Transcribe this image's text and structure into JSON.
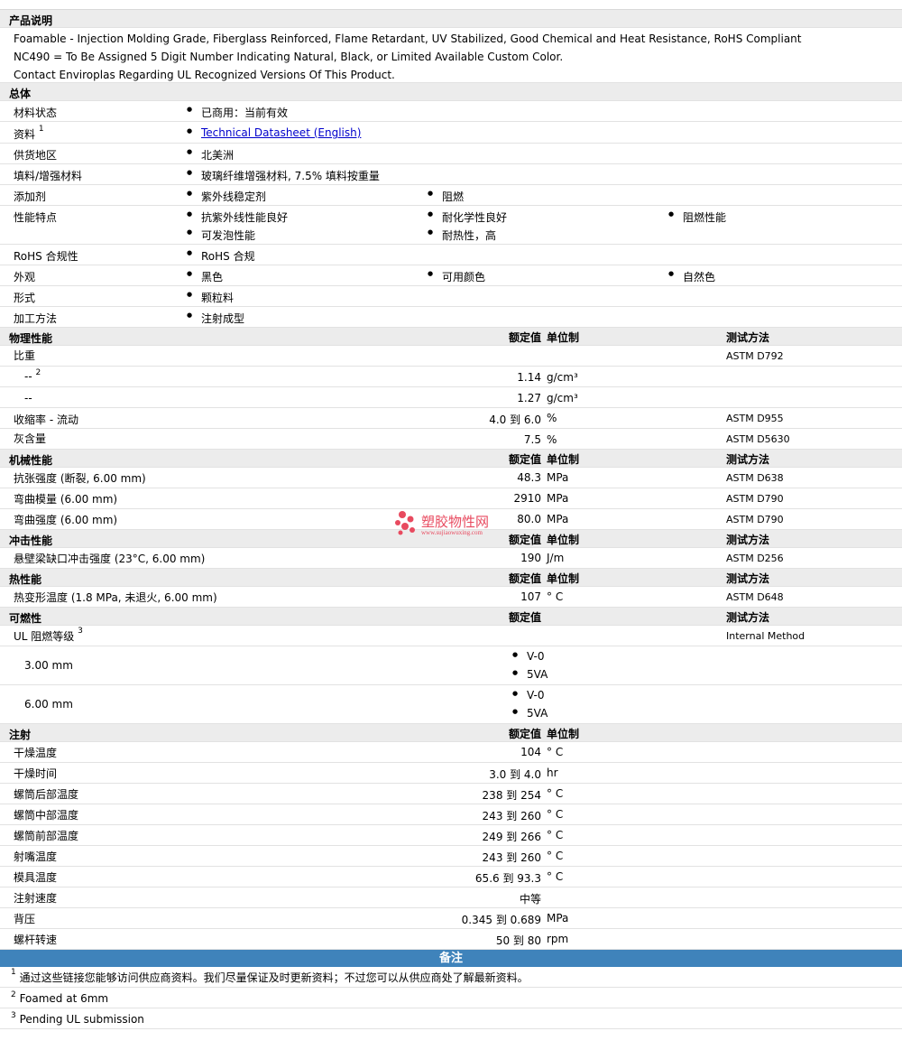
{
  "description": {
    "title": "产品说明",
    "lines": [
      "Foamable - Injection Molding Grade, Fiberglass Reinforced, Flame Retardant, UV Stabilized, Good Chemical and Heat Resistance, RoHS Compliant",
      "NC490 = To Be Assigned 5 Digit Number Indicating Natural, Black, or Limited Available Custom Color.",
      "Contact Enviroplas Regarding UL Recognized Versions Of This Product."
    ]
  },
  "general": {
    "title": "总体",
    "material_status": {
      "label": "材料状态",
      "value": "已商用：当前有效"
    },
    "documents": {
      "label": "资料",
      "sup": "1",
      "link": "Technical Datasheet (English)"
    },
    "availability": {
      "label": "供货地区",
      "value": "北美洲"
    },
    "filler": {
      "label": "填料/增强材料",
      "value": "玻璃纤维增强材料, 7.5% 填料按重量"
    },
    "additives": {
      "label": "添加剂",
      "values": [
        "紫外线稳定剂",
        "阻燃"
      ]
    },
    "features": {
      "label": "性能特点",
      "values": [
        "抗紫外线性能良好",
        "耐化学性良好",
        "阻燃性能",
        "可发泡性能",
        "耐热性，高"
      ]
    },
    "rohs": {
      "label": "RoHS 合规性",
      "value": "RoHS 合规"
    },
    "appearance": {
      "label": "外观",
      "values": [
        "黑色",
        "可用颜色",
        "自然色"
      ]
    },
    "forms": {
      "label": "形式",
      "value": "颗粒料"
    },
    "processing": {
      "label": "加工方法",
      "value": "注射成型"
    }
  },
  "col_headers": {
    "nominal": "额定值",
    "unit": "单位制",
    "method": "测试方法"
  },
  "physical": {
    "title": "物理性能",
    "rows": [
      {
        "label": "比重",
        "value": "",
        "unit": "",
        "method": "ASTM D792"
      },
      {
        "label": "--",
        "sup": "2",
        "value": "1.14",
        "unit": "g/cm³",
        "method": ""
      },
      {
        "label": "--",
        "value": "1.27",
        "unit": "g/cm³",
        "method": ""
      },
      {
        "label": "收缩率 - 流动",
        "value": "4.0 到 6.0",
        "unit": "%",
        "method": "ASTM D955"
      },
      {
        "label": "灰含量",
        "value": "7.5",
        "unit": "%",
        "method": "ASTM D5630"
      }
    ]
  },
  "mechanical": {
    "title": "机械性能",
    "rows": [
      {
        "label": "抗张强度 (断裂, 6.00 mm)",
        "value": "48.3",
        "unit": "MPa",
        "method": "ASTM D638"
      },
      {
        "label": "弯曲模量 (6.00 mm)",
        "value": "2910",
        "unit": "MPa",
        "method": "ASTM D790"
      },
      {
        "label": "弯曲强度 (6.00 mm)",
        "value": "80.0",
        "unit": "MPa",
        "method": "ASTM D790"
      }
    ]
  },
  "impact": {
    "title": "冲击性能",
    "rows": [
      {
        "label": "悬壁梁缺口冲击强度 (23°C, 6.00 mm)",
        "value": "190",
        "unit": "J/m",
        "method": "ASTM D256"
      }
    ]
  },
  "thermal": {
    "title": "热性能",
    "rows": [
      {
        "label": "热变形温度 (1.8 MPa, 未退火, 6.00 mm)",
        "value": "107",
        "unit": "° C",
        "method": "ASTM D648"
      }
    ]
  },
  "flammability": {
    "title": "可燃性",
    "ul": {
      "label": "UL 阻燃等级",
      "sup": "3",
      "method": "Internal Method"
    },
    "t300": {
      "label": "3.00 mm",
      "values": [
        "V-0",
        "5VA"
      ]
    },
    "t600": {
      "label": "6.00 mm",
      "values": [
        "V-0",
        "5VA"
      ]
    }
  },
  "injection": {
    "title": "注射",
    "rows": [
      {
        "label": "干燥温度",
        "value": "104",
        "unit": "° C"
      },
      {
        "label": "干燥时间",
        "value": "3.0 到 4.0",
        "unit": "hr"
      },
      {
        "label": "螺筒后部温度",
        "value": "238 到 254",
        "unit": "° C"
      },
      {
        "label": "螺筒中部温度",
        "value": "243 到 260",
        "unit": "° C"
      },
      {
        "label": "螺筒前部温度",
        "value": "249 到 266",
        "unit": "° C"
      },
      {
        "label": "射嘴温度",
        "value": "243 到 260",
        "unit": "° C"
      },
      {
        "label": "模具温度",
        "value": "65.6 到 93.3",
        "unit": "° C"
      },
      {
        "label": "注射速度",
        "value": "中等",
        "unit": ""
      },
      {
        "label": "背压",
        "value": "0.345 到 0.689",
        "unit": "MPa"
      },
      {
        "label": "螺杆转速",
        "value": "50 到 80",
        "unit": "rpm"
      }
    ]
  },
  "notes": {
    "title": "备注",
    "items": [
      {
        "num": "1",
        "text": "通过这些链接您能够访问供应商资料。我们尽量保证及时更新资料；不过您可以从供应商处了解最新资料。"
      },
      {
        "num": "2",
        "text": "Foamed at 6mm"
      },
      {
        "num": "3",
        "text": "Pending UL submission"
      }
    ]
  },
  "watermark": {
    "cn": "塑胶物性网",
    "en": "www.sujiaowuxing.com",
    "color": "#e84a5f"
  }
}
